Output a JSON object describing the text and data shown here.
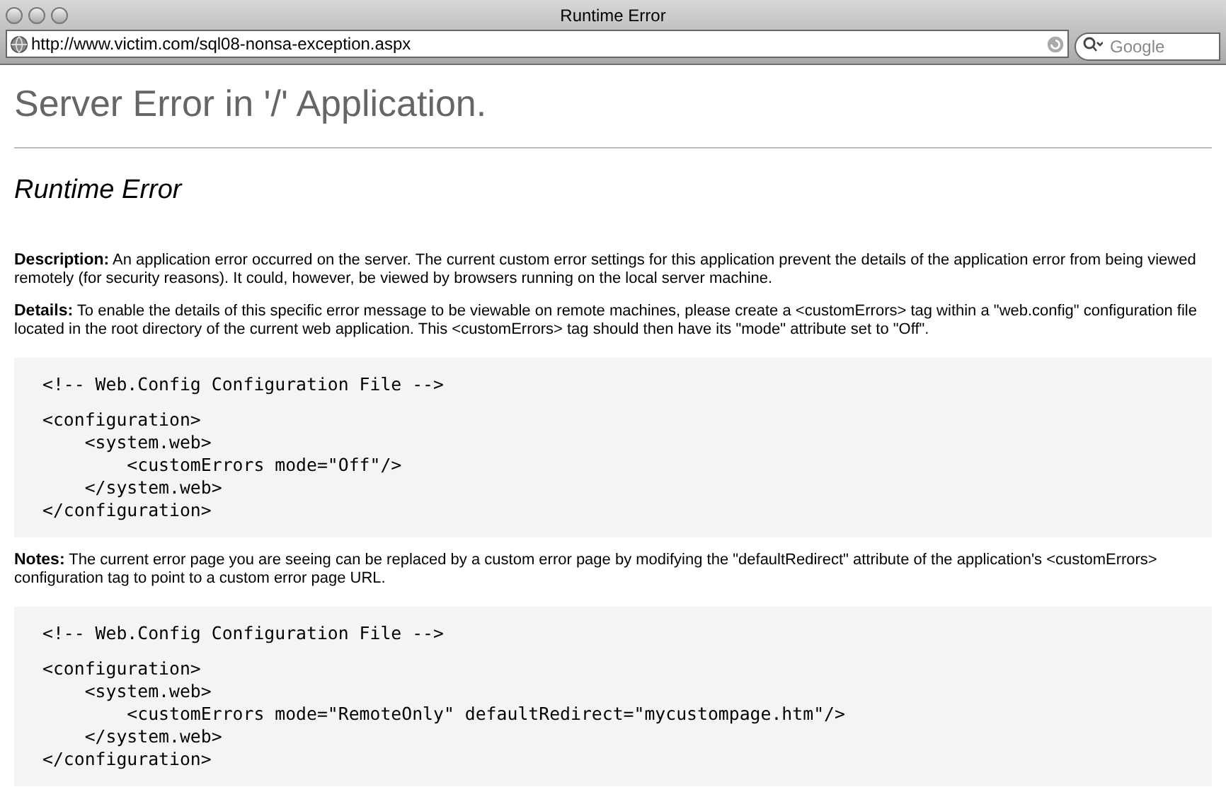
{
  "window": {
    "title": "Runtime Error"
  },
  "address_bar": {
    "value": "http://www.victim.com/sql08-nonsa-exception.aspx"
  },
  "search": {
    "placeholder": "Google"
  },
  "page": {
    "heading": "Server Error in '/' Application.",
    "subheading": "Runtime Error",
    "sections": [
      {
        "kind": "text",
        "label": "Description:",
        "text": "An application error occurred on the server. The current custom error settings for this application prevent the details of the application error from being viewed remotely (for security reasons). It could, however, be viewed by browsers running on the local server machine."
      },
      {
        "kind": "text",
        "label": "Details:",
        "text": "To enable the details of this specific error message to be viewable on remote machines, please create a <customErrors> tag within a \"web.config\" configuration file located in the root directory of the current web application. This <customErrors> tag should then have its \"mode\" attribute set to \"Off\"."
      },
      {
        "kind": "code",
        "comment": "<!-- Web.Config Configuration File -->",
        "lines": [
          "<configuration>",
          "    <system.web>",
          "        <customErrors mode=\"Off\"/>",
          "    </system.web>",
          "</configuration>"
        ]
      },
      {
        "kind": "text",
        "label": "Notes:",
        "text": "The current error page you are seeing can be replaced by a custom error page by modifying the \"defaultRedirect\" attribute of the application's <customErrors> configuration tag to point to a custom error page URL."
      },
      {
        "kind": "code",
        "comment": "<!-- Web.Config Configuration File -->",
        "lines": [
          "<configuration>",
          "    <system.web>",
          "        <customErrors mode=\"RemoteOnly\" defaultRedirect=\"mycustompage.htm\"/>",
          "    </system.web>",
          "</configuration>"
        ]
      }
    ]
  }
}
